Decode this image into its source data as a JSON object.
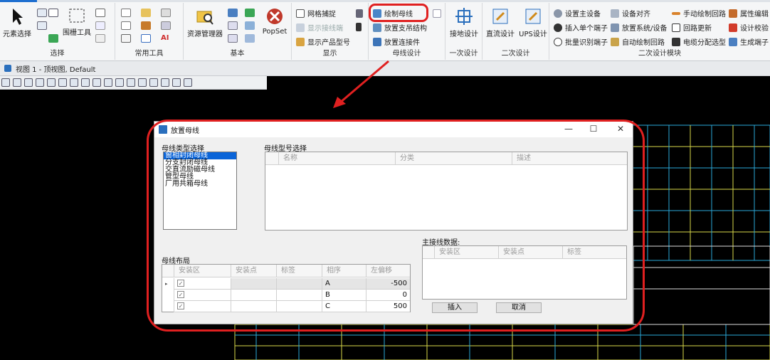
{
  "ribbon": {
    "groups": [
      {
        "label": "选择"
      },
      {
        "label": "常用工具"
      },
      {
        "label": "基本"
      },
      {
        "label": "显示"
      },
      {
        "label": "母线设计"
      },
      {
        "label": "一次设计"
      },
      {
        "label": "二次设计"
      },
      {
        "label": "二次设计模块"
      }
    ],
    "select": {
      "element_select": "元素选择",
      "fence_tool": "围栅工具"
    },
    "basic": {
      "resource_manager": "资源管理器",
      "popset": "PopSet"
    },
    "display": {
      "grid_snap": "网格捕捉",
      "show_terminal": "显示接线端",
      "show_model": "显示产品型号"
    },
    "busbar": {
      "draw_busbar": "绘制母线",
      "place_support": "放置支吊结构",
      "place_connector": "放置连接件"
    },
    "primary": {
      "grounding": "接地设计"
    },
    "secondary": {
      "dc": "直流设计",
      "ups": "UPS设计"
    },
    "module": {
      "set_main_device": "设置主设备",
      "insert_terminal": "插入单个端子",
      "batch_terminal": "批量识别端子",
      "device_align": "设备对齐",
      "place_system": "放置系统/设备",
      "auto_draw": "自动绘制回路",
      "manual_draw": "手动绘制回路",
      "loop_update": "回路更新",
      "cable_select": "电缆分配选型",
      "attr_edit": "属性编辑",
      "design_check": "设计校验",
      "gen_terminal": "生成端子"
    }
  },
  "view": {
    "title": "视图 1 - 顶视图, Default"
  },
  "dialog": {
    "title": "放置母线",
    "type_section": "母线类型选择",
    "types": [
      "窗相封闭母线",
      "分支封闭母线",
      "交直流励磁母线",
      "管型母线",
      "厂用共箱母线"
    ],
    "model_section": "母线型号选择",
    "model_columns": [
      "名称",
      "分类",
      "描述"
    ],
    "main_section": "主接线数据:",
    "main_columns": [
      "安装区",
      "安装点",
      "标签"
    ],
    "layout_section": "母线布局",
    "layout_columns": [
      "安装区",
      "安装点",
      "标签",
      "相序",
      "左偏移"
    ],
    "layout_rows": [
      {
        "checked": true,
        "phase": "A",
        "offset": "-500"
      },
      {
        "checked": true,
        "phase": "B",
        "offset": "0"
      },
      {
        "checked": true,
        "phase": "C",
        "offset": "500"
      }
    ],
    "insert": "插入",
    "cancel": "取消",
    "minimize": "—",
    "maximize": "☐",
    "close": "✕"
  }
}
